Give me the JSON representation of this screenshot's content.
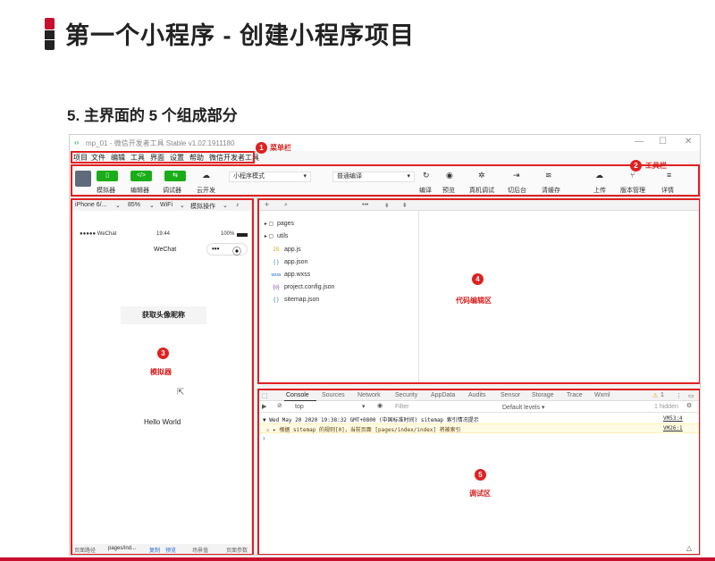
{
  "slide": {
    "title": "第一个小程序 - 创建小程序项目",
    "subtitle": "5. 主界面的 5 个组成部分"
  },
  "window": {
    "title": "mp_01 - 微信开发者工具 Stable v1.02.1911180",
    "controls": [
      "—",
      "☐",
      "✕"
    ]
  },
  "menu": [
    "项目",
    "文件",
    "编辑",
    "工具",
    "界面",
    "设置",
    "帮助",
    "微信开发者工具"
  ],
  "toolbar": {
    "mode_buttons": [
      {
        "icon": "▯",
        "label": "模拟器"
      },
      {
        "icon": "</>",
        "label": "编辑器"
      },
      {
        "icon": "⇆",
        "label": "调试器"
      }
    ],
    "cloud": {
      "icon": "☁",
      "label": "云开发"
    },
    "mode_select": "小程序模式",
    "compile_select": "普通编译",
    "right_buttons": [
      {
        "icon": "↻",
        "label": "编译"
      },
      {
        "icon": "◉",
        "label": "预览"
      },
      {
        "icon": "✲",
        "label": "真机调试"
      },
      {
        "icon": "⇥",
        "label": "切后台"
      },
      {
        "icon": "≋",
        "label": "清缓存"
      },
      {
        "icon": "☁",
        "label": "上传"
      },
      {
        "icon": "⑂",
        "label": "版本管理"
      },
      {
        "icon": "≡",
        "label": "详情"
      }
    ]
  },
  "simulator": {
    "device": "iPhone 6/...",
    "zoom": "85%",
    "network": "WiFi",
    "ops": "模拟操作",
    "status_left": "●●●●● WeChat",
    "status_time": "19:44",
    "status_battery": "100%",
    "nav_title": "WeChat",
    "nav_more": "•••",
    "nav_close": "⦿",
    "get_avatar": "获取头像昵称",
    "hello": "Hello World",
    "footer_path_label": "页面路径",
    "footer_path": "pages/ind...",
    "footer_copy": "复制",
    "footer_preview": "预览",
    "footer_scene": "场景值",
    "footer_params": "页面参数"
  },
  "editor": {
    "toolbar_icons": [
      "+",
      "⌕",
      "•••",
      "⇟",
      "⇞"
    ],
    "files": [
      {
        "type": "folder",
        "icon": "▸ ▢",
        "name": "pages"
      },
      {
        "type": "folder",
        "icon": "▸ ▢",
        "name": "utils"
      },
      {
        "type": "js",
        "icon": "JS",
        "name": "app.js"
      },
      {
        "type": "json",
        "icon": "{ }",
        "name": "app.json"
      },
      {
        "type": "wxss",
        "icon": "wxss",
        "name": "app.wxss"
      },
      {
        "type": "json",
        "icon": "{o}",
        "name": "project.config.json"
      },
      {
        "type": "json",
        "icon": "{ }",
        "name": "sitemap.json"
      }
    ]
  },
  "debug": {
    "tabs": [
      "Console",
      "Sources",
      "Network",
      "Security",
      "AppData",
      "Audits",
      "Sensor",
      "Storage",
      "Trace",
      "Wxml"
    ],
    "active_tab": "Console",
    "warn_count": "1",
    "context": "top",
    "filter_placeholder": "Filter",
    "levels": "Default levels ▾",
    "hidden": "1 hidden",
    "log1": "▼ Wed May 20 2020 19:38:32 GMT+0800 (中国标准时间) sitemap 索引情况提示",
    "log1_src": "VM53:4",
    "log2": "⚠ ▸ 根据 sitemap 的规则[0]，当前页面 [pages/index/index] 将被索引",
    "log2_src": "VM26:1",
    "prompt": "›"
  },
  "callouts": [
    {
      "num": "1",
      "label": "菜单栏"
    },
    {
      "num": "2",
      "label": "工具栏"
    },
    {
      "num": "3",
      "label": "模拟器"
    },
    {
      "num": "4",
      "label": "代码编辑区"
    },
    {
      "num": "5",
      "label": "调试区"
    }
  ],
  "colors": {
    "accent": "#c8102e",
    "callout": "#e02020",
    "wechat_green": "#1aad19"
  }
}
